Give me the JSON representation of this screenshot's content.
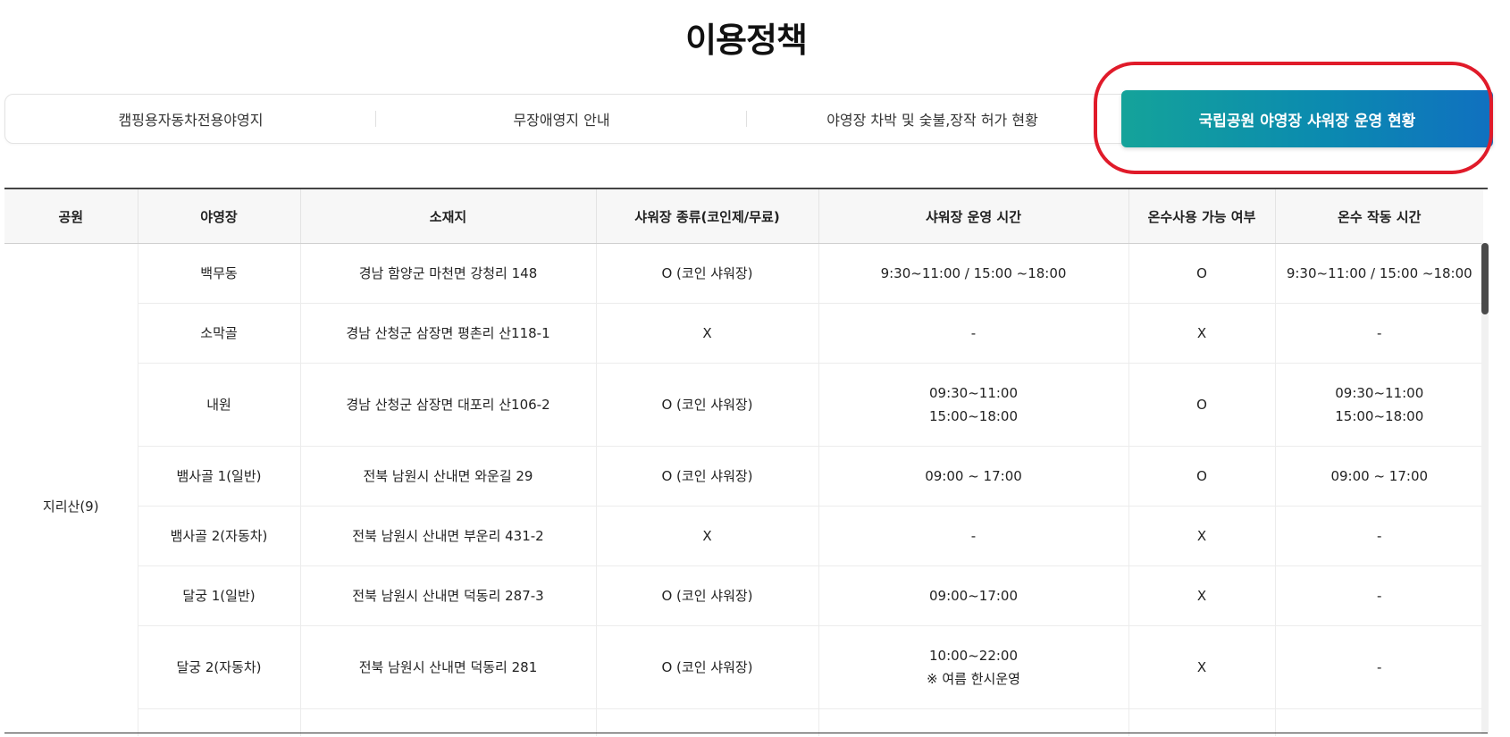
{
  "page": {
    "title": "이용정책"
  },
  "tabs": [
    {
      "label": "캠핑용자동차전용야영지",
      "active": false
    },
    {
      "label": "무장애영지 안내",
      "active": false
    },
    {
      "label": "야영장 차박 및 숯불,장작 허가 현황",
      "active": false
    },
    {
      "label": "국립공원 야영장 샤워장 운영 현황",
      "active": true
    }
  ],
  "colors": {
    "active_tab_start": "#14a39a",
    "active_tab_end": "#1070c0",
    "highlight_ring": "#e01b2a",
    "header_bg": "#f7f7f7"
  },
  "table": {
    "headers": [
      "공원",
      "야영장",
      "소재지",
      "샤워장 종류(코인제/무료)",
      "샤워장 운영 시간",
      "온수사용 가능 여부",
      "온수 작동 시간"
    ],
    "park": "지리산(9)",
    "rows": [
      {
        "campsite": "백무동",
        "address": "경남 함양군 마천면 강청리 148",
        "shower_type": "O (코인 샤워장)",
        "shower_hours": [
          "9:30~11:00 / 15:00 ~18:00"
        ],
        "hot_water": "O",
        "hot_water_hours": [
          "9:30~11:00 / 15:00 ~18:00"
        ]
      },
      {
        "campsite": "소막골",
        "address": "경남 산청군 삼장면 평촌리 산118-1",
        "shower_type": "X",
        "shower_hours": [
          "-"
        ],
        "hot_water": "X",
        "hot_water_hours": [
          "-"
        ]
      },
      {
        "campsite": "내원",
        "address": "경남 산청군 삼장면 대포리 산106-2",
        "shower_type": "O (코인 샤워장)",
        "shower_hours": [
          "09:30~11:00",
          "15:00~18:00"
        ],
        "hot_water": "O",
        "hot_water_hours": [
          "09:30~11:00",
          "15:00~18:00"
        ]
      },
      {
        "campsite": "뱀사골 1(일반)",
        "address": "전북 남원시 산내면 와운길 29",
        "shower_type": "O (코인 샤워장)",
        "shower_hours": [
          "09:00 ~ 17:00"
        ],
        "hot_water": "O",
        "hot_water_hours": [
          "09:00 ~ 17:00"
        ]
      },
      {
        "campsite": "뱀사골 2(자동차)",
        "address": "전북 남원시 산내면 부운리 431-2",
        "shower_type": "X",
        "shower_hours": [
          "-"
        ],
        "hot_water": "X",
        "hot_water_hours": [
          "-"
        ]
      },
      {
        "campsite": "달궁 1(일반)",
        "address": "전북 남원시 산내면 덕동리 287-3",
        "shower_type": "O (코인 샤워장)",
        "shower_hours": [
          "09:00~17:00"
        ],
        "hot_water": "X",
        "hot_water_hours": [
          "-"
        ]
      },
      {
        "campsite": "달궁 2(자동차)",
        "address": "전북 남원시 산내면 덕동리 281",
        "shower_type": "O (코인 샤워장)",
        "shower_hours": [
          "10:00~22:00",
          "※ 여름 한시운영"
        ],
        "hot_water": "X",
        "hot_water_hours": [
          "-"
        ]
      }
    ]
  }
}
